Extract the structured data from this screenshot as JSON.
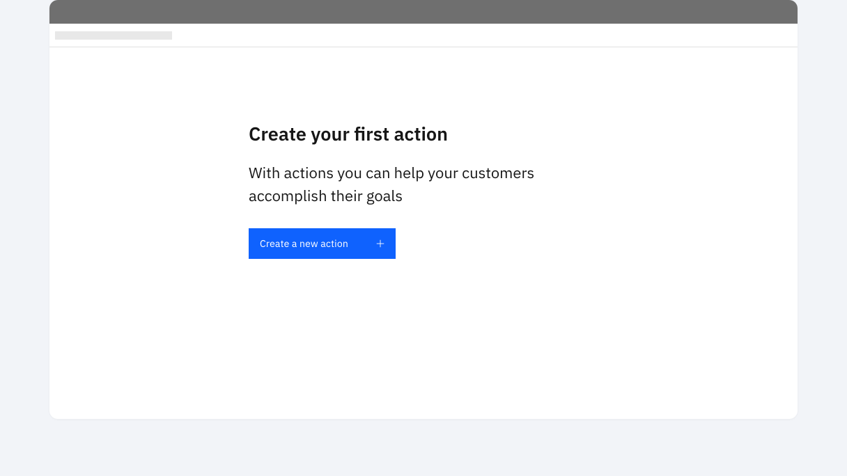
{
  "main": {
    "heading": "Create your first action",
    "description": "With actions you can help your customers accomplish their goals",
    "cta_label": "Create a new action"
  },
  "colors": {
    "primary": "#0f62fe",
    "text": "#161616",
    "background": "#f2f4f8",
    "panel": "#ffffff",
    "titlebar": "#6f6f6f"
  }
}
